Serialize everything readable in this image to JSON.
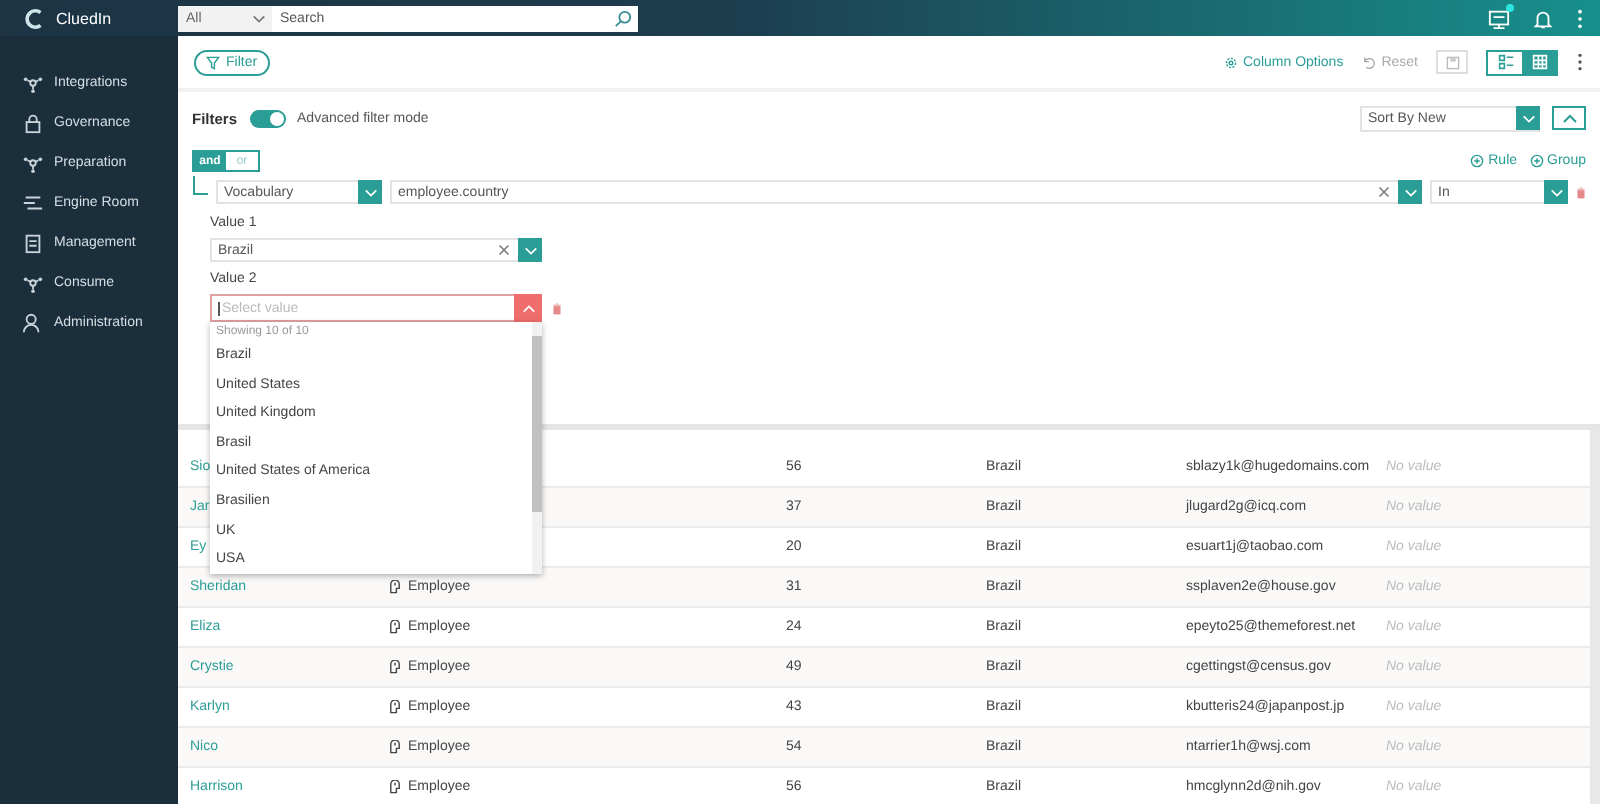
{
  "app": {
    "name": "CluedIn"
  },
  "search": {
    "scope": "All",
    "placeholder": "Search"
  },
  "topbar": {
    "notification_dot": true
  },
  "sidebar": {
    "items": [
      {
        "label": "Integrations",
        "kind": "integrations"
      },
      {
        "label": "Governance",
        "kind": "governance"
      },
      {
        "label": "Preparation",
        "kind": "preparation"
      },
      {
        "label": "Engine Room",
        "kind": "engine"
      },
      {
        "label": "Management",
        "kind": "management"
      },
      {
        "label": "Consume",
        "kind": "consume"
      },
      {
        "label": "Administration",
        "kind": "administration"
      }
    ]
  },
  "toolbar": {
    "filter": "Filter",
    "column_options": "Column Options",
    "reset": {
      "label": "Reset",
      "disabled": true
    },
    "views": [
      {
        "kind": "list",
        "selected": false
      },
      {
        "kind": "grid",
        "selected": true
      }
    ]
  },
  "filters": {
    "title": "Filters",
    "advanced_on": true,
    "advanced_label": "Advanced filter mode",
    "sort": "Sort By New",
    "logic": [
      {
        "label": "and",
        "selected": true
      },
      {
        "label": "or",
        "selected": false
      }
    ],
    "add": [
      {
        "label": "Rule"
      },
      {
        "label": "Group"
      }
    ],
    "rule": {
      "source": "Vocabulary",
      "field": "employee.country",
      "operator": "In"
    },
    "value_1": {
      "label": "Value 1",
      "value": "Brazil"
    },
    "value_2": {
      "label": "Value 2",
      "placeholder": "Select value",
      "expanded": true
    },
    "dropdown": {
      "status": "Showing 10 of 10",
      "options": [
        "Brazil",
        "United States",
        "United Kingdom",
        "Brasil",
        "United States of America",
        "Brasilien",
        "UK",
        "USA"
      ]
    }
  },
  "table": {
    "rows": [
      {
        "name": "Sio",
        "type": "",
        "age": "56",
        "country": "Brazil",
        "email": "sblazy1k@hugedomains.com",
        "column_6": "No value"
      },
      {
        "name": "Jar",
        "type": "",
        "age": "37",
        "country": "Brazil",
        "email": "jlugard2g@icq.com",
        "column_6": "No value"
      },
      {
        "name": "Ey",
        "type": "",
        "age": "20",
        "country": "Brazil",
        "email": "esuart1j@taobao.com",
        "column_6": "No value"
      },
      {
        "name": "Sheridan",
        "type": "Employee",
        "age": "31",
        "country": "Brazil",
        "email": "ssplaven2e@house.gov",
        "column_6": "No value"
      },
      {
        "name": "Eliza",
        "type": "Employee",
        "age": "24",
        "country": "Brazil",
        "email": "epeyto25@themeforest.net",
        "column_6": "No value"
      },
      {
        "name": "Crystie",
        "type": "Employee",
        "age": "49",
        "country": "Brazil",
        "email": "cgettingst@census.gov",
        "column_6": "No value"
      },
      {
        "name": "Karlyn",
        "type": "Employee",
        "age": "43",
        "country": "Brazil",
        "email": "kbutteris24@japanpost.jp",
        "column_6": "No value"
      },
      {
        "name": "Nico",
        "type": "Employee",
        "age": "54",
        "country": "Brazil",
        "email": "ntarrier1h@wsj.com",
        "column_6": "No value"
      },
      {
        "name": "Harrison",
        "type": "Employee",
        "age": "56",
        "country": "Brazil",
        "email": "hmcglynn2d@nih.gov",
        "column_6": "No value"
      }
    ]
  }
}
